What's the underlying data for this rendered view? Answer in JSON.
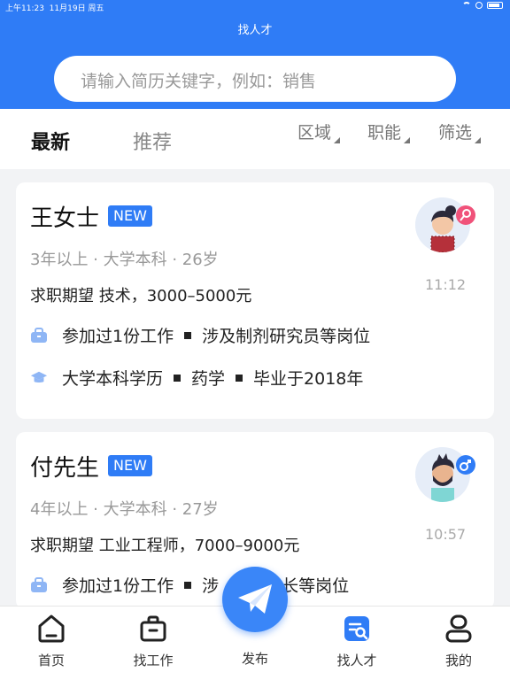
{
  "status_bar": {
    "time": "上午11:23",
    "date": "11月19日 周五"
  },
  "header": {
    "title": "找人才"
  },
  "search": {
    "placeholder": "请输入简历关键字，例如：销售"
  },
  "tabs": [
    {
      "label": "最新"
    },
    {
      "label": "推荐"
    }
  ],
  "filters": [
    {
      "label": "区域"
    },
    {
      "label": "职能"
    },
    {
      "label": "筛选"
    }
  ],
  "candidates": [
    {
      "name": "王女士",
      "badge": "NEW",
      "meta": "3年以上 · 大学本科 · 26岁",
      "expectation": "求职期望 技术，3000–5000元",
      "work": "参加过1份工作",
      "work_detail": "涉及制剂研究员等岗位",
      "edu": "大学本科学历",
      "major": "药学",
      "graduation": "毕业于2018年",
      "time": "11:12",
      "gender_icon": "female-icon"
    },
    {
      "name": "付先生",
      "badge": "NEW",
      "meta": "4年以上 · 大学本科 · 27岁",
      "expectation": "求职期望 工业工程师，7000–9000元",
      "work": "参加过1份工作",
      "work_detail": "涉",
      "work_detail_tail": "组长等岗位",
      "time": "10:57",
      "gender_icon": "male-icon"
    }
  ],
  "bottom_nav": [
    {
      "label": "首页",
      "icon": "home-icon"
    },
    {
      "label": "找工作",
      "icon": "briefcase-icon"
    },
    {
      "label": "发布",
      "icon": "paper-plane-icon"
    },
    {
      "label": "找人才",
      "icon": "talent-search-icon"
    },
    {
      "label": "我的",
      "icon": "user-icon"
    }
  ],
  "colors": {
    "primary": "#2f7cf6",
    "female_badge": "#f0527a",
    "male_badge": "#2f7cf6"
  }
}
